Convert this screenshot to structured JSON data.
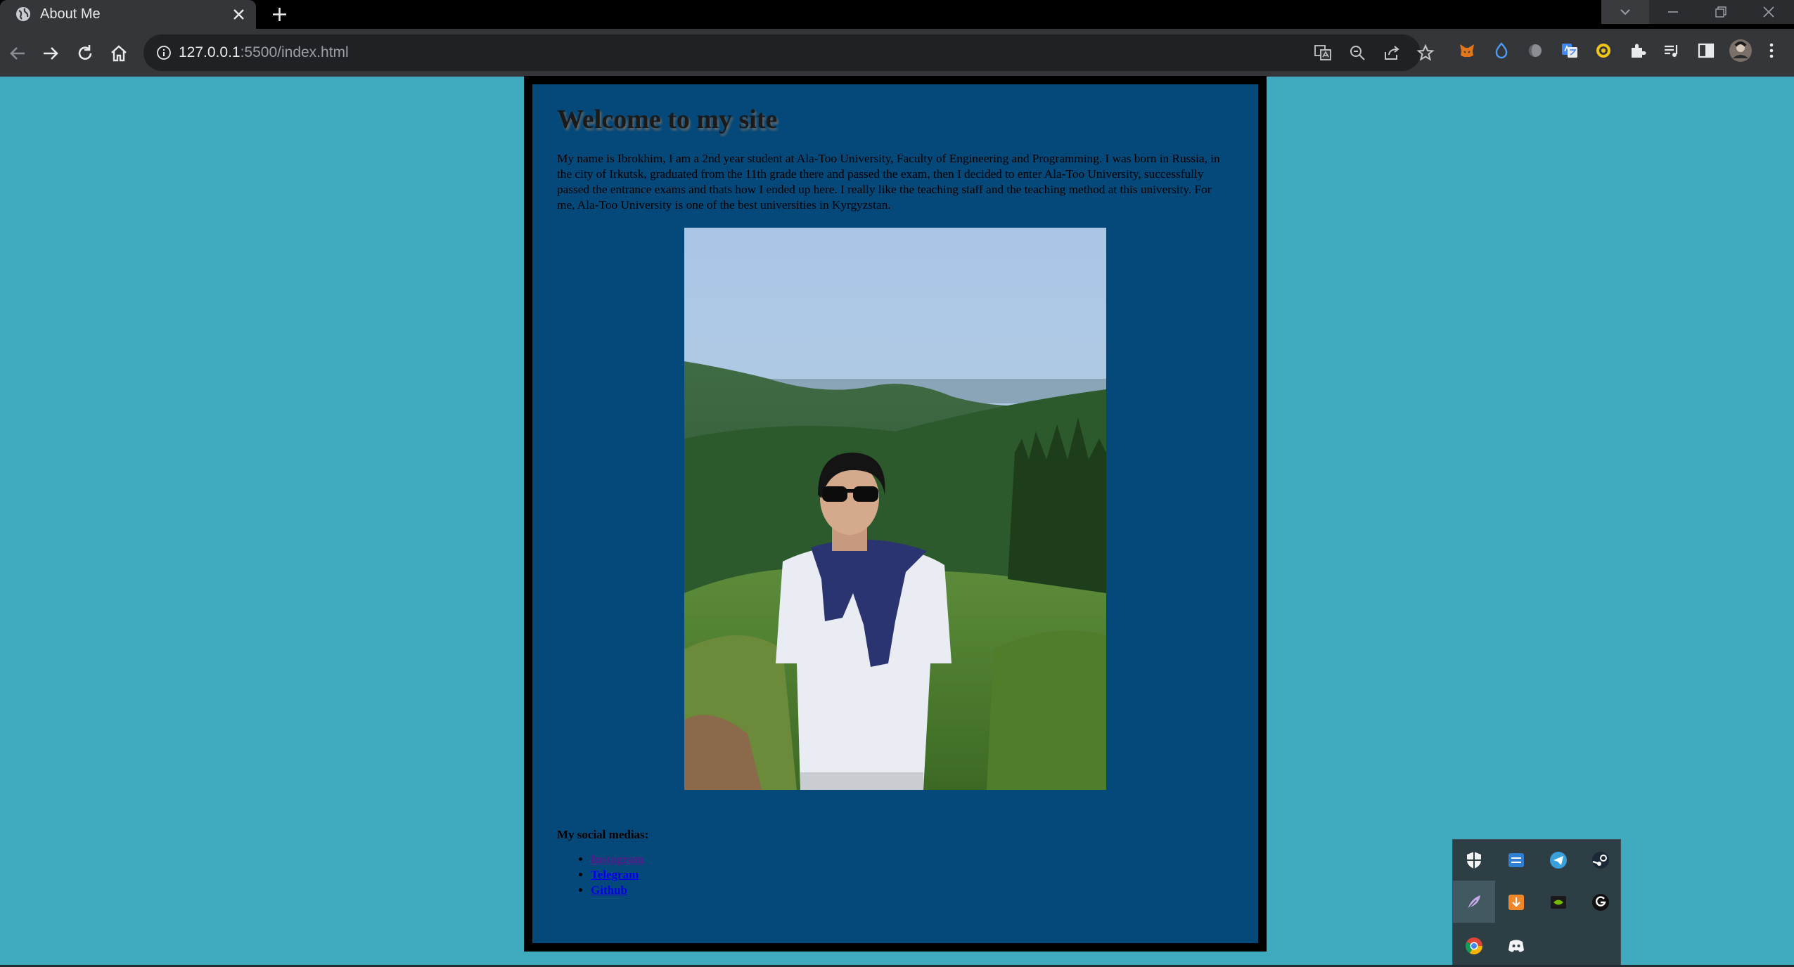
{
  "browser": {
    "tab_title": "About Me",
    "url_host": "127.0.0.1",
    "url_path": ":5500/index.html"
  },
  "page": {
    "heading": "Welcome to my site",
    "intro": "My name is Ibrokhim, I am a 2nd year student at Ala-Too University, Faculty of Engineering and Programming. I was born in Russia, in the city of Irkutsk, graduated from the 11th grade there and passed the exam, then I decided to enter Ala-Too University, successfully passed the entrance exams and thats how I ended up here. I really like the teaching staff and the teaching method at this university. For me, Ala-Too University is one of the best universities in Kyrgyzstan.",
    "social_heading": "My social medias:",
    "social_links": [
      "Instagram",
      "Telegram",
      "Github"
    ]
  },
  "colors": {
    "page_background": "#3fa9bd",
    "card_background": "#04497a",
    "card_border": "#000000"
  }
}
